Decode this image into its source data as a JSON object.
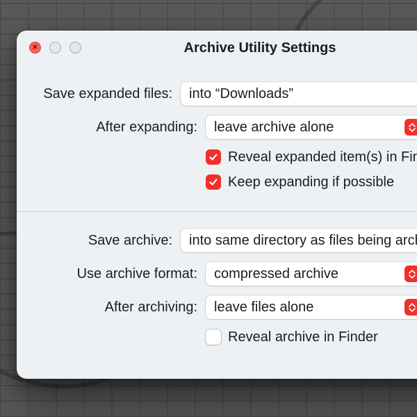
{
  "window": {
    "title": "Archive Utility Settings"
  },
  "expand": {
    "save_label": "Save expanded files:",
    "save_value": "into “Downloads”",
    "after_label": "After expanding:",
    "after_value": "leave archive alone",
    "reveal_checked": true,
    "reveal_label": "Reveal expanded item(s) in Finder",
    "keep_checked": true,
    "keep_label": "Keep expanding if possible"
  },
  "archive": {
    "save_label": "Save archive:",
    "save_value": "into same directory as files being archived",
    "format_label": "Use archive format:",
    "format_value": "compressed archive",
    "after_label": "After archiving:",
    "after_value": "leave files alone",
    "reveal_checked": false,
    "reveal_label": "Reveal archive in Finder"
  }
}
